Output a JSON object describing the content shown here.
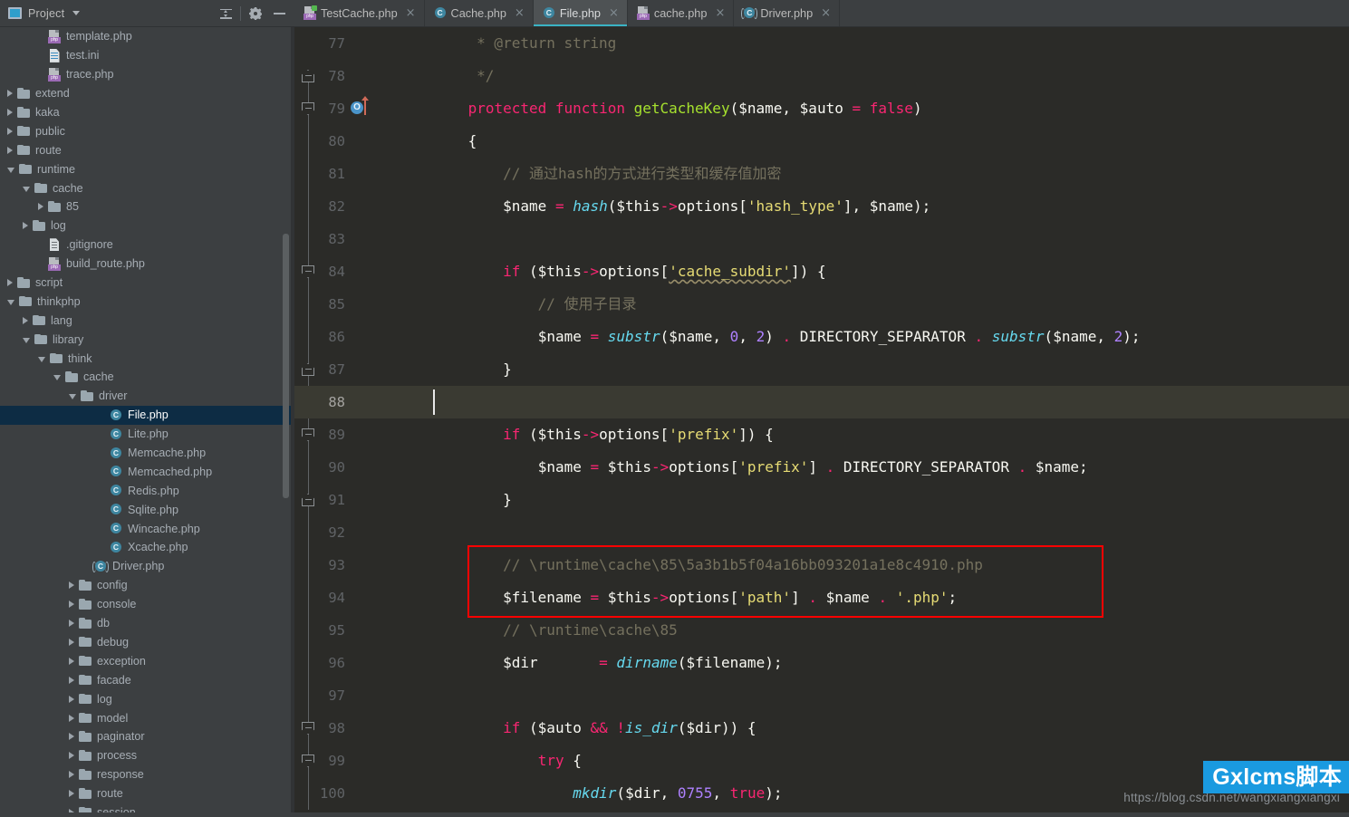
{
  "project_panel": {
    "title": "Project",
    "icon": "project-icon",
    "tools": [
      "collapse-all-icon",
      "settings-gear-icon",
      "minimize-icon"
    ]
  },
  "tabs": [
    {
      "label": "TestCache.php",
      "icon": "php-file-icon",
      "active": false,
      "close": "×"
    },
    {
      "label": "Cache.php",
      "icon": "php-class-icon",
      "active": false,
      "close": "×"
    },
    {
      "label": "File.php",
      "icon": "php-class-icon",
      "active": true,
      "close": "×"
    },
    {
      "label": "cache.php",
      "icon": "php-file-icon",
      "active": false,
      "close": "×"
    },
    {
      "label": "Driver.php",
      "icon": "php-abstract-class-icon",
      "active": false,
      "close": "×"
    }
  ],
  "tree": [
    {
      "label": "template.php",
      "indent": 3,
      "icon": "php-file-icon",
      "state": "leaf"
    },
    {
      "label": "test.ini",
      "indent": 3,
      "icon": "ini-file-icon",
      "state": "leaf"
    },
    {
      "label": "trace.php",
      "indent": 3,
      "icon": "php-file-icon",
      "state": "leaf"
    },
    {
      "label": "extend",
      "indent": 1,
      "icon": "folder-icon",
      "state": "collapsed"
    },
    {
      "label": "kaka",
      "indent": 1,
      "icon": "folder-icon",
      "state": "collapsed"
    },
    {
      "label": "public",
      "indent": 1,
      "icon": "folder-icon",
      "state": "collapsed"
    },
    {
      "label": "route",
      "indent": 1,
      "icon": "folder-icon",
      "state": "collapsed"
    },
    {
      "label": "runtime",
      "indent": 1,
      "icon": "folder-icon",
      "state": "expanded"
    },
    {
      "label": "cache",
      "indent": 2,
      "icon": "folder-icon",
      "state": "expanded"
    },
    {
      "label": "85",
      "indent": 3,
      "icon": "folder-icon",
      "state": "collapsed"
    },
    {
      "label": "log",
      "indent": 2,
      "icon": "folder-icon",
      "state": "collapsed"
    },
    {
      "label": ".gitignore",
      "indent": 3,
      "icon": "gitignore-file-icon",
      "state": "leaf"
    },
    {
      "label": "build_route.php",
      "indent": 3,
      "icon": "php-file-icon",
      "state": "leaf"
    },
    {
      "label": "script",
      "indent": 1,
      "icon": "folder-icon",
      "state": "collapsed"
    },
    {
      "label": "thinkphp",
      "indent": 1,
      "icon": "folder-icon",
      "state": "expanded"
    },
    {
      "label": "lang",
      "indent": 2,
      "icon": "folder-icon",
      "state": "collapsed"
    },
    {
      "label": "library",
      "indent": 2,
      "icon": "folder-icon",
      "state": "expanded"
    },
    {
      "label": "think",
      "indent": 3,
      "icon": "folder-icon",
      "state": "expanded"
    },
    {
      "label": "cache",
      "indent": 4,
      "icon": "folder-icon",
      "state": "expanded"
    },
    {
      "label": "driver",
      "indent": 5,
      "icon": "folder-icon",
      "state": "expanded"
    },
    {
      "label": "File.php",
      "indent": 7,
      "icon": "php-class-icon",
      "state": "leaf",
      "selected": true
    },
    {
      "label": "Lite.php",
      "indent": 7,
      "icon": "php-class-icon",
      "state": "leaf"
    },
    {
      "label": "Memcache.php",
      "indent": 7,
      "icon": "php-class-icon",
      "state": "leaf"
    },
    {
      "label": "Memcached.php",
      "indent": 7,
      "icon": "php-class-icon",
      "state": "leaf"
    },
    {
      "label": "Redis.php",
      "indent": 7,
      "icon": "php-class-icon",
      "state": "leaf"
    },
    {
      "label": "Sqlite.php",
      "indent": 7,
      "icon": "php-class-icon",
      "state": "leaf"
    },
    {
      "label": "Wincache.php",
      "indent": 7,
      "icon": "php-class-icon",
      "state": "leaf"
    },
    {
      "label": "Xcache.php",
      "indent": 7,
      "icon": "php-class-icon",
      "state": "leaf"
    },
    {
      "label": "Driver.php",
      "indent": 6,
      "icon": "php-abstract-class-icon",
      "state": "leaf"
    },
    {
      "label": "config",
      "indent": 5,
      "icon": "folder-icon",
      "state": "collapsed"
    },
    {
      "label": "console",
      "indent": 5,
      "icon": "folder-icon",
      "state": "collapsed"
    },
    {
      "label": "db",
      "indent": 5,
      "icon": "folder-icon",
      "state": "collapsed"
    },
    {
      "label": "debug",
      "indent": 5,
      "icon": "folder-icon",
      "state": "collapsed"
    },
    {
      "label": "exception",
      "indent": 5,
      "icon": "folder-icon",
      "state": "collapsed"
    },
    {
      "label": "facade",
      "indent": 5,
      "icon": "folder-icon",
      "state": "collapsed"
    },
    {
      "label": "log",
      "indent": 5,
      "icon": "folder-icon",
      "state": "collapsed"
    },
    {
      "label": "model",
      "indent": 5,
      "icon": "folder-icon",
      "state": "collapsed"
    },
    {
      "label": "paginator",
      "indent": 5,
      "icon": "folder-icon",
      "state": "collapsed"
    },
    {
      "label": "process",
      "indent": 5,
      "icon": "folder-icon",
      "state": "collapsed"
    },
    {
      "label": "response",
      "indent": 5,
      "icon": "folder-icon",
      "state": "collapsed"
    },
    {
      "label": "route",
      "indent": 5,
      "icon": "folder-icon",
      "state": "collapsed"
    },
    {
      "label": "session",
      "indent": 5,
      "icon": "folder-icon",
      "state": "collapsed"
    }
  ],
  "editor": {
    "first_line": 77,
    "current_line": 88,
    "line_numbers": [
      77,
      78,
      79,
      80,
      81,
      82,
      83,
      84,
      85,
      86,
      87,
      88,
      89,
      90,
      91,
      92,
      93,
      94,
      95,
      96,
      97,
      98,
      99,
      100
    ],
    "lines": [
      "     * @return string",
      "     */",
      "    protected function getCacheKey($name, $auto = false)",
      "    {",
      "        // 通过hash的方式进行类型和缓存值加密",
      "        $name = hash($this->options['hash_type'], $name);",
      "",
      "        if ($this->options['cache_subdir']) {",
      "            // 使用子目录",
      "            $name = substr($name, 0, 2) . DIRECTORY_SEPARATOR . substr($name, 2);",
      "        }",
      "",
      "        if ($this->options['prefix']) {",
      "            $name = $this->options['prefix'] . DIRECTORY_SEPARATOR . $name;",
      "        }",
      "",
      "        // \\runtime\\cache\\85\\5a3b1b5f04a16bb093201a1e8c4910.php",
      "        $filename = $this->options['path'] . $name . '.php';",
      "        // \\runtime\\cache\\85",
      "        $dir       = dirname($filename);",
      "",
      "        if ($auto && !is_dir($dir)) {",
      "            try {",
      "                mkdir($dir, 0755, true);"
    ],
    "highlight_box": {
      "lines": [
        93,
        94
      ],
      "color": "#ff0000"
    },
    "gutter_marker": {
      "line": 79,
      "icon": "overriding-method-icon",
      "label": "O"
    }
  },
  "watermark": {
    "url": "https://blog.csdn.net/wangxiangxiangxi",
    "badge": "Gxlcms脚本",
    "badge_color": "#1a9ae0"
  },
  "theme": {
    "editor_bg": "#2b2b28",
    "panel_bg": "#3c3f41",
    "selection_bg": "#0d2c44",
    "caret_line_bg": "#3a3a32",
    "accent": "#3ab3c4"
  }
}
